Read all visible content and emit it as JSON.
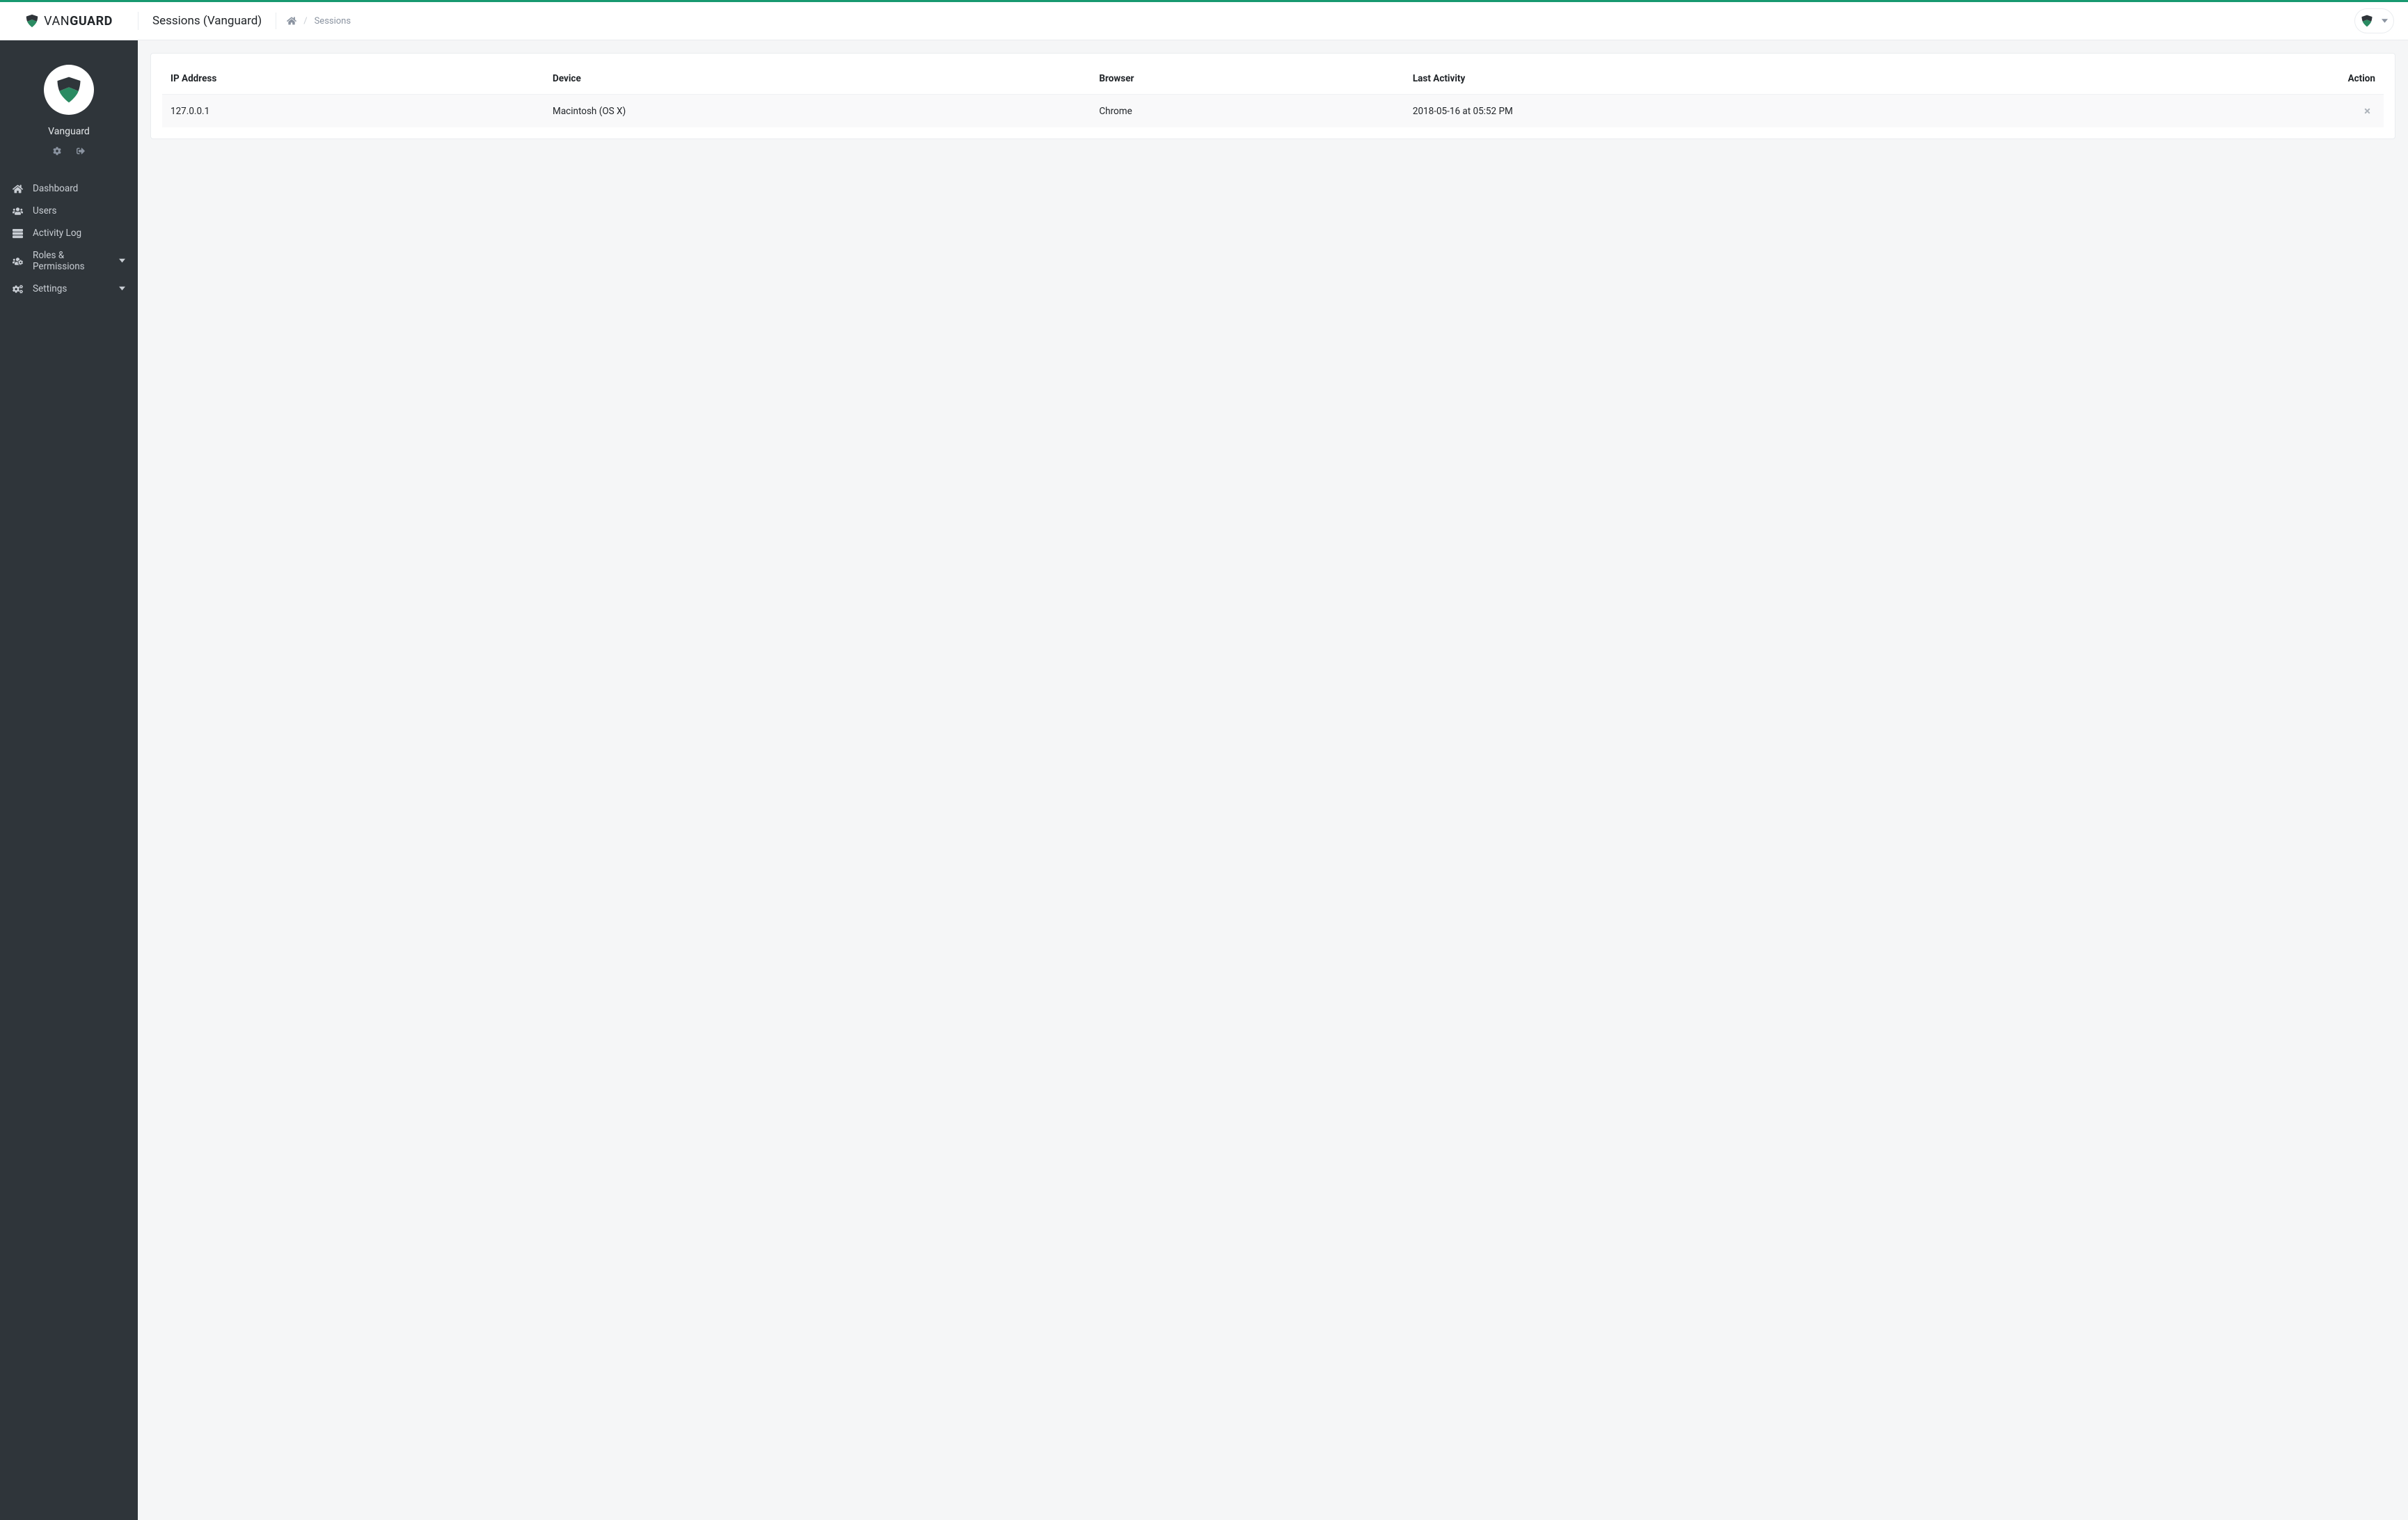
{
  "brand": {
    "text_light": "VAN",
    "text_bold": "GUARD"
  },
  "page_title": "Sessions (Vanguard)",
  "breadcrumb": {
    "current": "Sessions"
  },
  "sidebar": {
    "username": "Vanguard",
    "items": [
      {
        "icon": "dashboard",
        "label": "Dashboard",
        "expandable": false
      },
      {
        "icon": "users",
        "label": "Users",
        "expandable": false
      },
      {
        "icon": "activity",
        "label": "Activity Log",
        "expandable": false
      },
      {
        "icon": "roles",
        "label": "Roles & Permissions",
        "expandable": true
      },
      {
        "icon": "settings",
        "label": "Settings",
        "expandable": true
      }
    ]
  },
  "table": {
    "headers": {
      "ip": "IP Address",
      "device": "Device",
      "browser": "Browser",
      "last_activity": "Last Activity",
      "action": "Action"
    },
    "rows": [
      {
        "ip": "127.0.0.1",
        "device": "Macintosh (OS X)",
        "browser": "Chrome",
        "last_activity": "2018-05-16 at 05:52 PM"
      }
    ]
  }
}
